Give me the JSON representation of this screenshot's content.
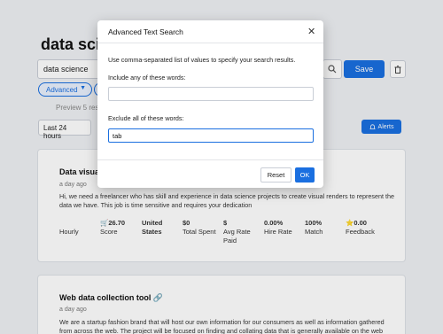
{
  "page": {
    "title": "data scienc",
    "search_value": "data science",
    "save_label": "Save",
    "advanced_label": "Advanced",
    "preview_label": "Preview 5 resu",
    "time_filter": "Last 24 hours",
    "alerts_label": "Alerts"
  },
  "jobs": [
    {
      "title": "Data visuali",
      "date": "a day ago",
      "description": "Hi, we need a freelancer who has skill and experience in data science projects to create visual renders to represent the data we have. This job is time sensitive and requires your dedication",
      "stats": [
        {
          "value": "",
          "label": "Hourly"
        },
        {
          "value": "🛒26.70",
          "label": "Score"
        },
        {
          "value": "United",
          "label": "States"
        },
        {
          "value": "$0",
          "label": "Total Spent"
        },
        {
          "value": "$",
          "label": "Avg Rate Paid"
        },
        {
          "value": "0.00%",
          "label": "Hire Rate"
        },
        {
          "value": "100%",
          "label": "Match"
        },
        {
          "value": "⭐0.00",
          "label": "Feedback"
        }
      ]
    },
    {
      "title": "Web data collection tool 🔗",
      "date": "a day ago",
      "description": "We are a startup fashion brand that will host our own information for our consumers as well as information gathered from across the web. The project will be focused on finding and collating data that is generally available on the web"
    }
  ],
  "modal": {
    "title": "Advanced Text Search",
    "close_symbol": "✕",
    "instructions": "Use comma-separated list of values to specify your search results.",
    "include_label": "Include any of these words:",
    "include_value": "",
    "exclude_label": "Exclude all of these words:",
    "exclude_value": "tab",
    "reset_label": "Reset",
    "ok_label": "OK"
  },
  "colors": {
    "accent": "#1a6fe0",
    "background": "#eef0f3"
  }
}
